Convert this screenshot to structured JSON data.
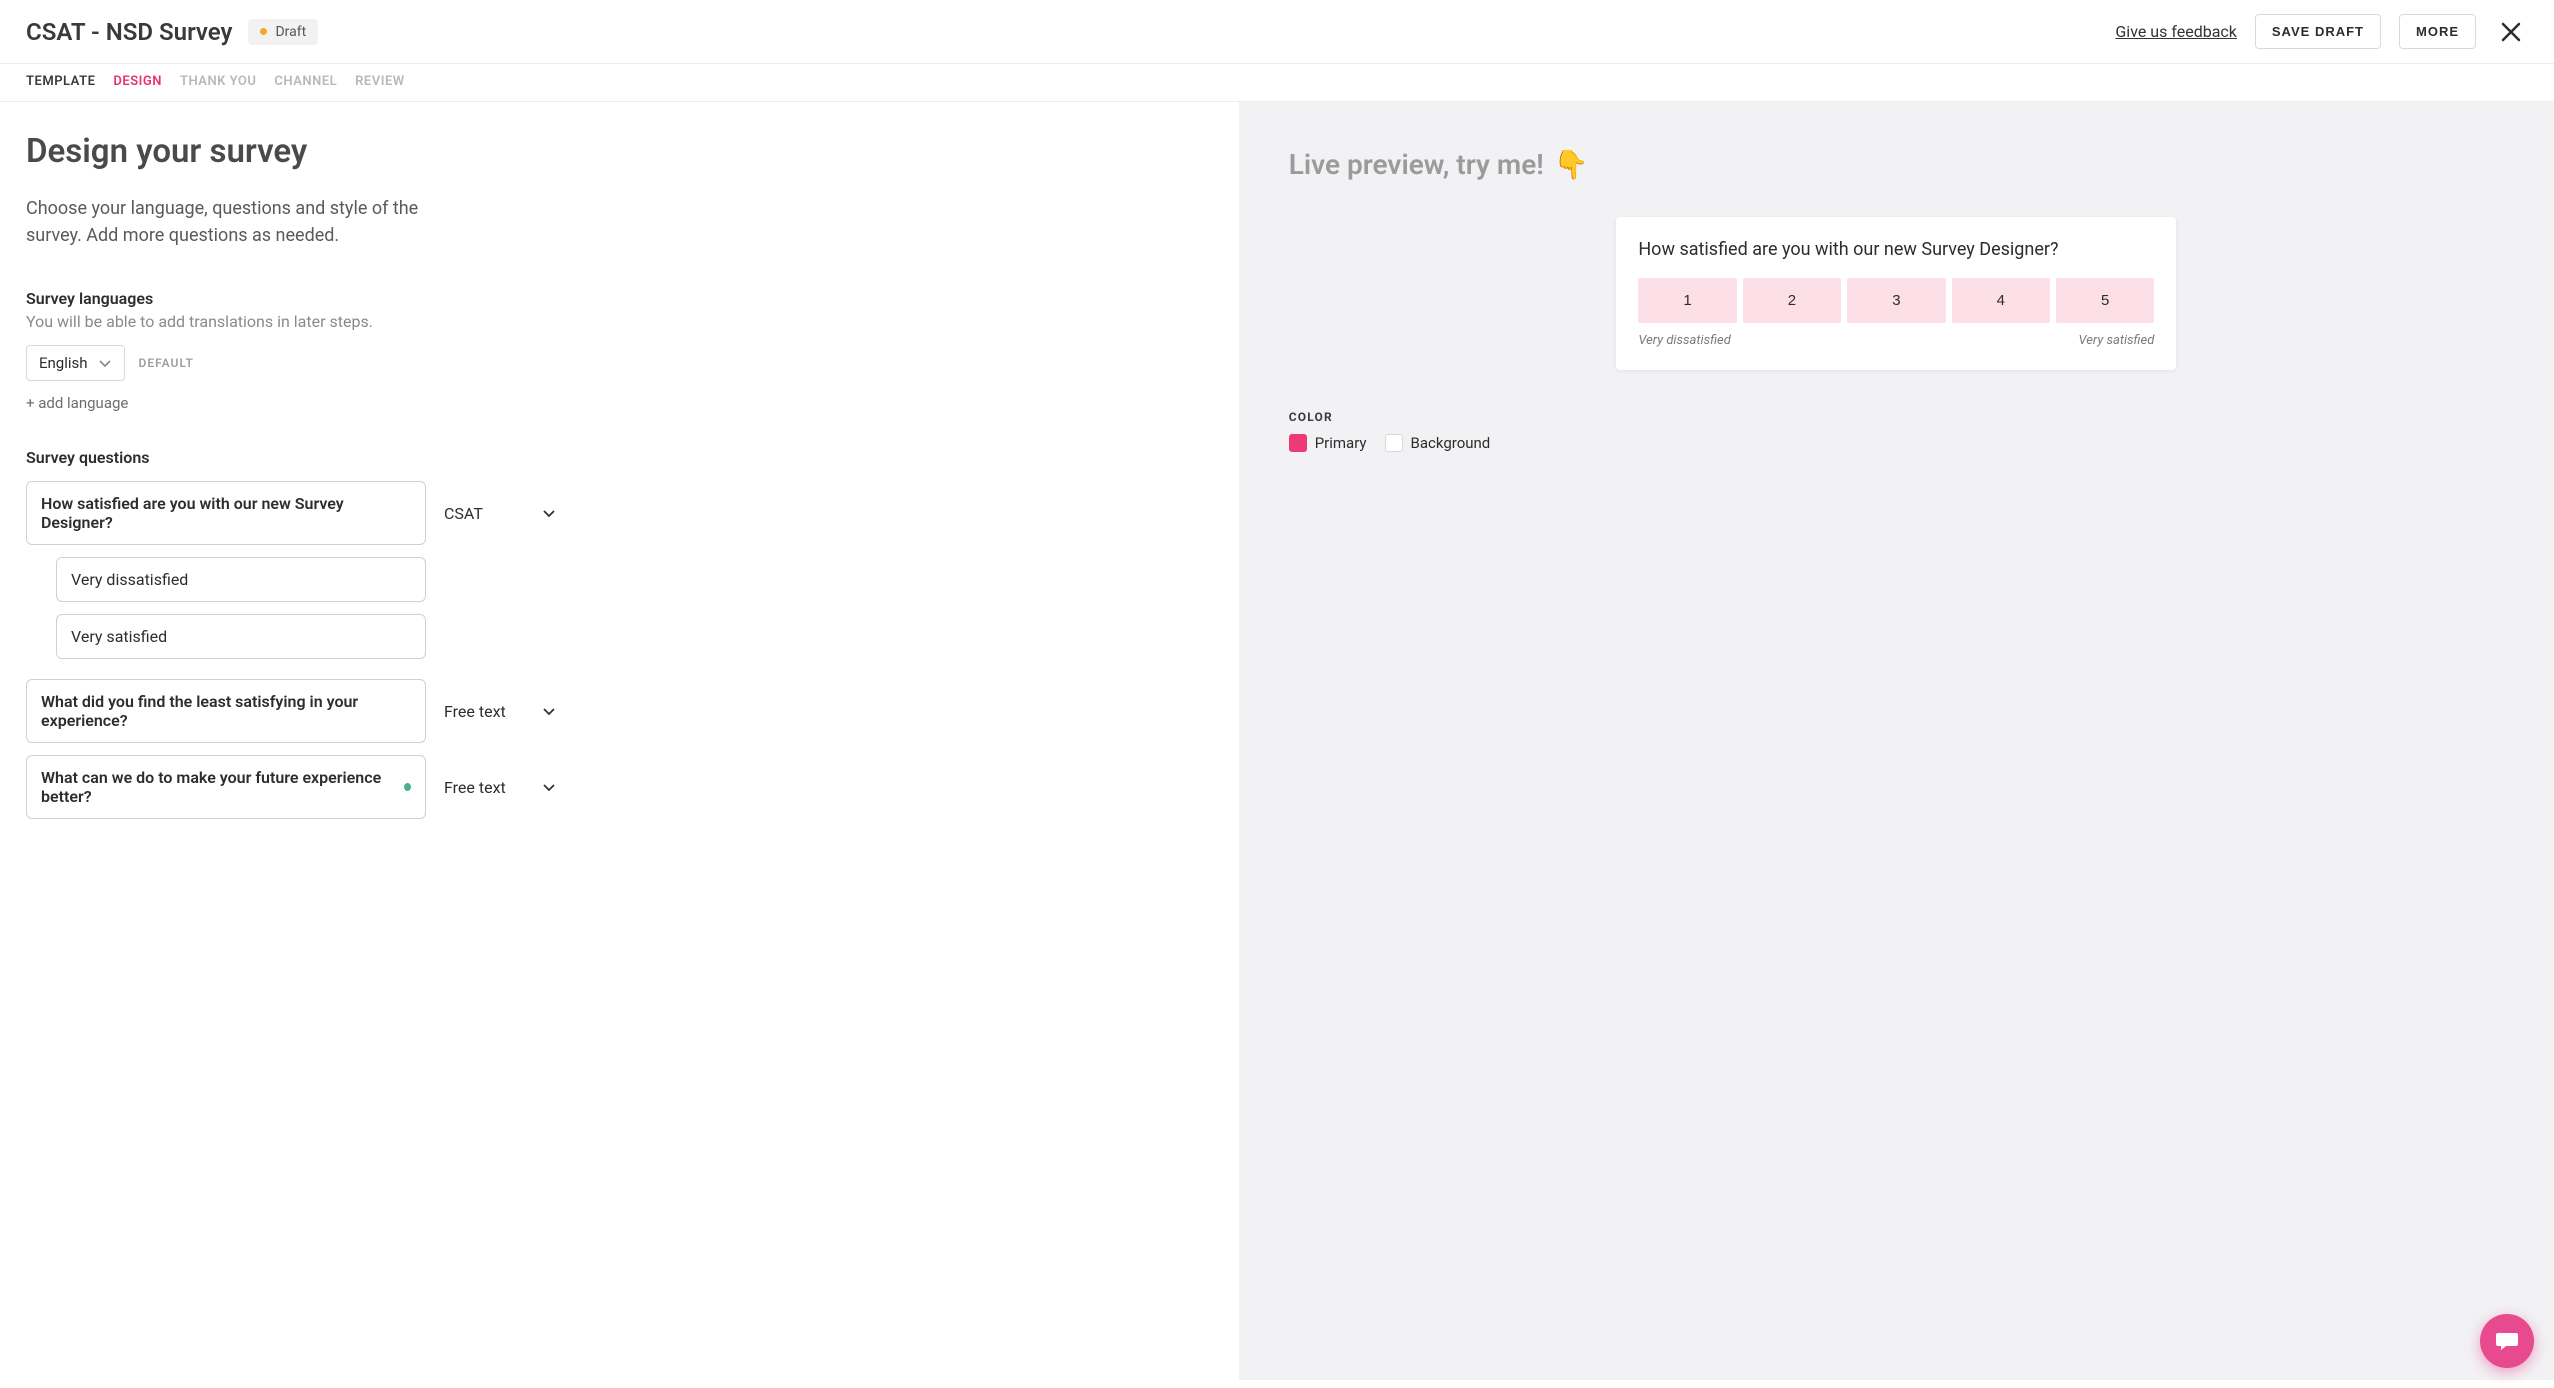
{
  "header": {
    "title": "CSAT - NSD Survey",
    "badge_status": "Draft",
    "feedback_link": "Give us feedback",
    "save_draft_label": "SAVE DRAFT",
    "more_label": "MORE"
  },
  "tabs": {
    "template": "TEMPLATE",
    "design": "DESIGN",
    "thank_you": "THANK YOU",
    "channel": "CHANNEL",
    "review": "REVIEW"
  },
  "page": {
    "title": "Design your survey",
    "description": "Choose your language, questions and style of the survey. Add more questions as needed."
  },
  "languages": {
    "section_label": "Survey languages",
    "hint": "You will be able to add translations in later steps.",
    "selected": "English",
    "default_tag": "DEFAULT",
    "add_label": "+ add language"
  },
  "questions": {
    "section_label": "Survey questions",
    "items": [
      {
        "text": "How satisfied are you with our new Survey Designer?",
        "type": "CSAT",
        "scale_low": "Very dissatisfied",
        "scale_high": "Very satisfied"
      },
      {
        "text": "What did you find the least satisfying in your experience?",
        "type": "Free text"
      },
      {
        "text": "What can we do to make your future experience better?",
        "type": "Free text"
      }
    ]
  },
  "preview": {
    "title": "Live preview, try me!",
    "emoji": "👇",
    "question": "How satisfied are you with our new Survey Designer?",
    "ratings": [
      "1",
      "2",
      "3",
      "4",
      "5"
    ],
    "label_low": "Very dissatisfied",
    "label_high": "Very satisfied"
  },
  "color": {
    "heading": "COLOR",
    "primary_label": "Primary",
    "background_label": "Background",
    "primary_hex": "#ed3976",
    "background_hex": "#ffffff"
  }
}
